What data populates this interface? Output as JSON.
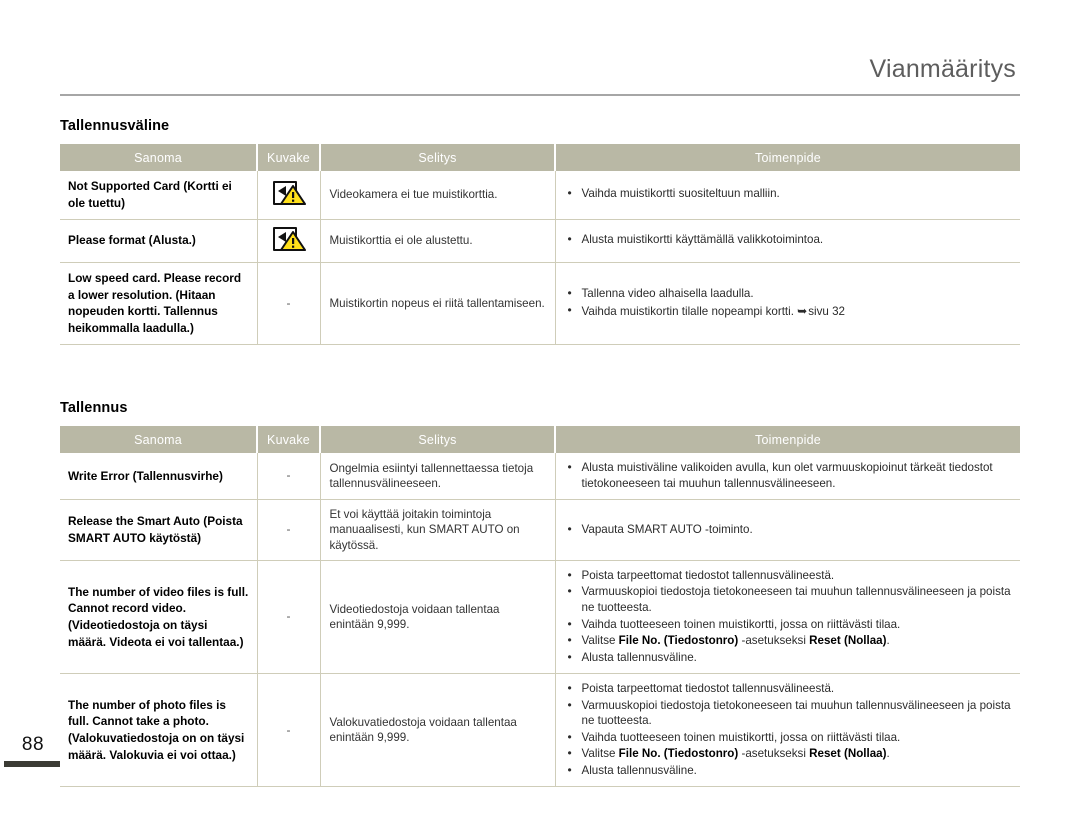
{
  "header": {
    "title": "Vianmääritys"
  },
  "page_number": "88",
  "icons": {
    "card_warning": "memory-card-warning-icon",
    "page_ref_arrow": "➥"
  },
  "columns": [
    "Sanoma",
    "Kuvake",
    "Selitys",
    "Toimenpide"
  ],
  "sections": [
    {
      "title": "Tallennusväline",
      "rows": [
        {
          "message": "Not Supported Card (Kortti ei ole tuettu)",
          "icon": "card-warning",
          "icon_text": "",
          "explanation": "Videokamera ei tue muistikorttia.",
          "actions": [
            {
              "text": "Vaihda muistikortti suositeltuun malliin."
            }
          ]
        },
        {
          "message": "Please format (Alusta.)",
          "icon": "card-warning",
          "icon_text": "",
          "explanation": "Muistikorttia ei ole alustettu.",
          "actions": [
            {
              "text": "Alusta muistikortti käyttämällä valikkotoimintoa."
            }
          ]
        },
        {
          "message": "Low speed card. Please record a lower resolution. (Hitaan nopeuden kortti. Tallennus heikommalla laadulla.)",
          "icon": "dash",
          "icon_text": "-",
          "explanation": "Muistikortin nopeus ei riitä tallentamiseen.",
          "actions": [
            {
              "text": "Tallenna video alhaisella laadulla."
            },
            {
              "text": "Vaihda muistikortin tilalle nopeampi kortti.",
              "ref_arrow": "➥",
              "ref_text": "sivu 32"
            }
          ]
        }
      ]
    },
    {
      "title": "Tallennus",
      "rows": [
        {
          "message": "Write Error (Tallennusvirhe)",
          "icon": "dash",
          "icon_text": "-",
          "explanation": "Ongelmia esiintyi tallennettaessa tietoja tallennusvälineeseen.",
          "actions": [
            {
              "text": "Alusta muistiväline valikoiden avulla, kun olet varmuuskopioinut tärkeät tiedostot tietokoneeseen tai muuhun tallennusvälineeseen."
            }
          ]
        },
        {
          "message": "Release the Smart Auto (Poista SMART AUTO käytöstä)",
          "icon": "dash",
          "icon_text": "-",
          "explanation": "Et voi käyttää joitakin toimintoja manuaalisesti, kun SMART AUTO on käytössä.",
          "actions": [
            {
              "text": "Vapauta SMART AUTO -toiminto."
            }
          ]
        },
        {
          "message": "The number of video files is full. Cannot record video. (Videotiedostoja on täysi määrä. Videota ei voi tallentaa.)",
          "icon": "dash",
          "icon_text": "-",
          "explanation": "Videotiedostoja voidaan tallentaa enintään 9,999.",
          "actions": [
            {
              "text": "Poista tarpeettomat tiedostot tallennusvälineestä."
            },
            {
              "text": "Varmuuskopioi tiedostoja tietokoneeseen tai muuhun tallennusvälineeseen ja poista ne tuotteesta."
            },
            {
              "text": "Vaihda tuotteeseen toinen muistikortti, jossa on riittävästi tilaa."
            },
            {
              "html": "Valitse <b>File No. (Tiedostonro)</b> -asetukseksi <b>Reset (Nollaa)</b>."
            },
            {
              "text": "Alusta tallennusväline."
            }
          ]
        },
        {
          "message": "The number of photo files is full. Cannot take a photo. (Valokuvatiedostoja on on täysi määrä. Valokuvia ei voi ottaa.)",
          "icon": "dash",
          "icon_text": "-",
          "explanation": "Valokuvatiedostoja voidaan tallentaa enintään 9,999.",
          "actions": [
            {
              "text": "Poista tarpeettomat tiedostot tallennusvälineestä."
            },
            {
              "text": "Varmuuskopioi tiedostoja tietokoneeseen tai muuhun tallennusvälineeseen ja poista ne tuotteesta."
            },
            {
              "text": "Vaihda tuotteeseen toinen muistikortti, jossa on riittävästi tilaa."
            },
            {
              "html": "Valitse <b>File No. (Tiedostonro)</b> -asetukseksi <b>Reset (Nollaa)</b>."
            },
            {
              "text": "Alusta tallennusväline."
            }
          ]
        }
      ]
    }
  ],
  "colors": {
    "header_rule": "#a6a6a6",
    "table_header_bg": "#b9b8a5",
    "table_border": "#cfcdb9",
    "warning_yellow": "#ffe01b",
    "page_bar": "#3b3b34"
  }
}
